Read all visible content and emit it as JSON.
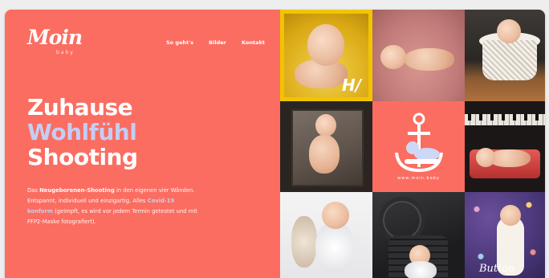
{
  "brand": {
    "logo_text": "Moin",
    "logo_sub": "baby"
  },
  "nav": {
    "items": [
      "So geht's",
      "Bilder",
      "Kontakt"
    ]
  },
  "hero": {
    "line1": "Zuhause",
    "line2": "Wohlfühl",
    "line3": "Shooting"
  },
  "paragraph": {
    "p1": "Das ",
    "bold": "Neugeborenen-Shooting",
    "p2": " in den eigenen vier Wänden. Entspannt, individuell und einzigartig. Alles ",
    "link": "Covid-19 konform",
    "p3": " (geimpft, es wird vor jedem Termin getestet und mit FFP2-Maske fotografiert)."
  },
  "gallery": {
    "tile1_mark": "H/",
    "tile5_caption": "www.moin.baby",
    "tile9_script": "Button"
  },
  "colors": {
    "coral": "#fb6d61",
    "periwinkle": "#c3cef4",
    "yellow_frame": "#f2c400",
    "background": "#eeeeee"
  },
  "icons": {
    "anchor_logo": "anchor-baby-icon"
  }
}
